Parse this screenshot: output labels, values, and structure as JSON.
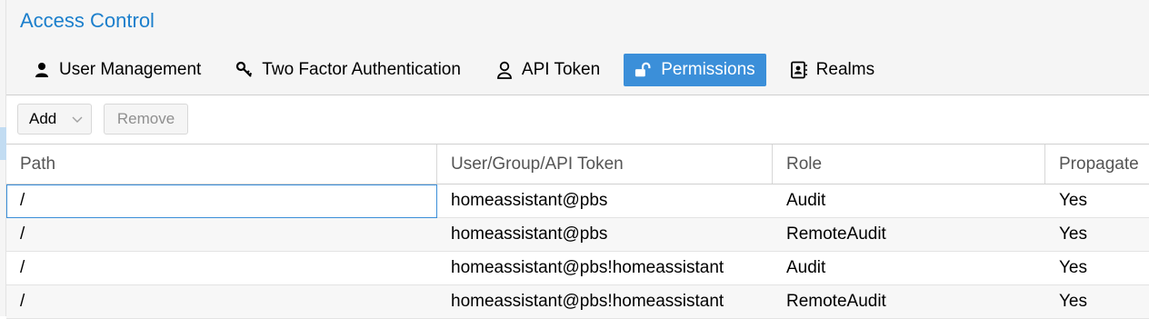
{
  "header": {
    "title": "Access Control"
  },
  "tabs": [
    {
      "label": "User Management",
      "icon": "user-icon",
      "active": false
    },
    {
      "label": "Two Factor Authentication",
      "icon": "key-icon",
      "active": false
    },
    {
      "label": "API Token",
      "icon": "user-outline-icon",
      "active": false
    },
    {
      "label": "Permissions",
      "icon": "unlock-icon",
      "active": true
    },
    {
      "label": "Realms",
      "icon": "address-book-icon",
      "active": false
    }
  ],
  "toolbar": {
    "add_label": "Add",
    "remove_label": "Remove"
  },
  "grid": {
    "columns": [
      "Path",
      "User/Group/API Token",
      "Role",
      "Propagate"
    ],
    "rows": [
      {
        "path": "/",
        "user": "homeassistant@pbs",
        "role": "Audit",
        "propagate": "Yes"
      },
      {
        "path": "/",
        "user": "homeassistant@pbs",
        "role": "RemoteAudit",
        "propagate": "Yes"
      },
      {
        "path": "/",
        "user": "homeassistant@pbs!homeassistant",
        "role": "Audit",
        "propagate": "Yes"
      },
      {
        "path": "/",
        "user": "homeassistant@pbs!homeassistant",
        "role": "RemoteAudit",
        "propagate": "Yes"
      }
    ]
  },
  "colors": {
    "accent": "#3b8fd9",
    "title": "#1c7fcc",
    "header_bg": "#f5f5f5"
  }
}
